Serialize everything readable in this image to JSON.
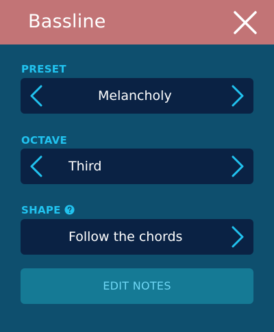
{
  "header": {
    "title": "Bassline"
  },
  "preset": {
    "label": "PRESET",
    "value": "Melancholy"
  },
  "octave": {
    "label": "OCTAVE",
    "value": "Third"
  },
  "shape": {
    "label": "SHAPE",
    "value": "Follow the chords"
  },
  "edit_button": {
    "label": "EDIT NOTES"
  },
  "icons": {
    "close": "close-icon",
    "prev": "chevron-left-icon",
    "next": "chevron-right-icon",
    "help": "help-icon"
  },
  "colors": {
    "header_bg": "#c27476",
    "panel_bg": "#0e4f6e",
    "selector_bg": "#0a2244",
    "accent": "#21c3f0",
    "button_bg": "#157a95"
  }
}
